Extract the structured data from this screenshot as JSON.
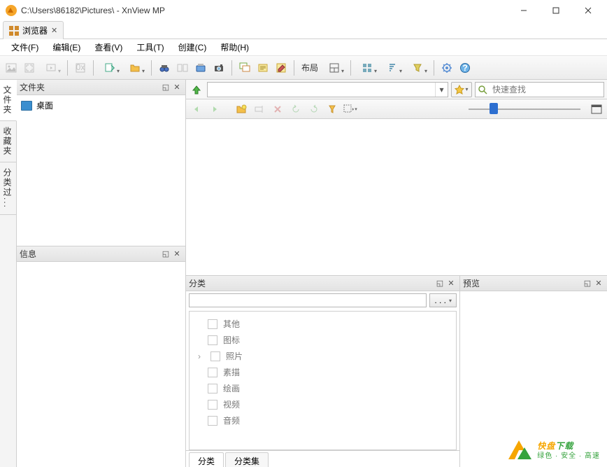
{
  "title": "C:\\Users\\86182\\Pictures\\ - XnView MP",
  "tabs": {
    "browser_label": "浏览器"
  },
  "menu": {
    "file": "文件(F)",
    "edit": "编辑(E)",
    "view": "查看(V)",
    "tools": "工具(T)",
    "create": "创建(C)",
    "help": "帮助(H)"
  },
  "toolbar": {
    "layout_label": "布局"
  },
  "sidetabs": {
    "folders": "文件夹",
    "favorites": "收藏夹",
    "catfilter": "分类过..."
  },
  "panels": {
    "folders_title": "文件夹",
    "info_title": "信息",
    "category_title": "分类",
    "preview_title": "预览"
  },
  "folder_tree": {
    "desktop": "桌面"
  },
  "search": {
    "placeholder": "快速查找"
  },
  "categories": {
    "items": [
      "其他",
      "图标",
      "照片",
      "素描",
      "绘画",
      "视频",
      "音频"
    ],
    "filter_button": ". . .",
    "tab_category": "分类",
    "tab_categoryset": "分类集"
  },
  "watermark": {
    "line1a": "快盘",
    "line1b": "下载",
    "line2": "绿色 · 安全 · 高速"
  }
}
